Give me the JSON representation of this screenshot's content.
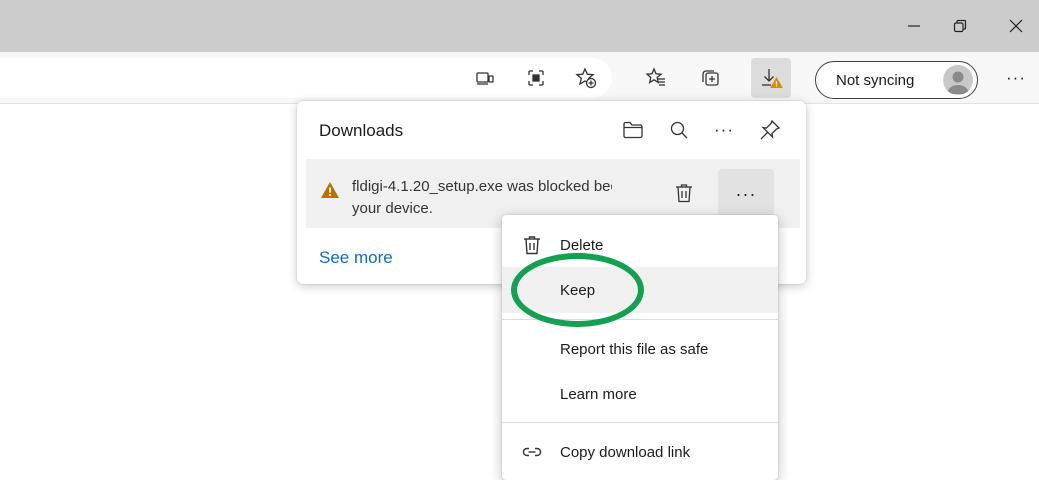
{
  "window": {
    "minimize_icon": "minimize-icon",
    "restore_icon": "restore-icon",
    "close_icon": "close-icon"
  },
  "toolbar": {
    "icons": [
      "immersive-reader-icon",
      "apps-icon",
      "add-favorite-icon",
      "favorites-icon",
      "collections-icon",
      "downloads-warning-icon"
    ],
    "profile_label": "Not syncing",
    "more_icon": "ellipsis-icon",
    "more_label": "···"
  },
  "downloads": {
    "title": "Downloads",
    "header_icons": [
      "folder-icon",
      "search-icon",
      "ellipsis-icon",
      "pin-icon"
    ],
    "header_more_label": "···",
    "item": {
      "line1": "fldigi-4.1.20_setup.exe was blocked bec",
      "line2": "your device.",
      "more_label": "···"
    },
    "see_more": "See more"
  },
  "context_menu": {
    "items": [
      {
        "label": "Delete",
        "icon": "trash-icon"
      },
      {
        "label": "Keep",
        "icon": ""
      },
      {
        "label": "Report this file as safe",
        "icon": ""
      },
      {
        "label": "Learn more",
        "icon": ""
      },
      {
        "label": "Copy download link",
        "icon": "link-icon"
      }
    ]
  },
  "colors": {
    "accent_link": "#0f6cbd",
    "warning": "#c07a00",
    "annotation_ring": "#12a150",
    "titlebar": "#cccccc"
  }
}
